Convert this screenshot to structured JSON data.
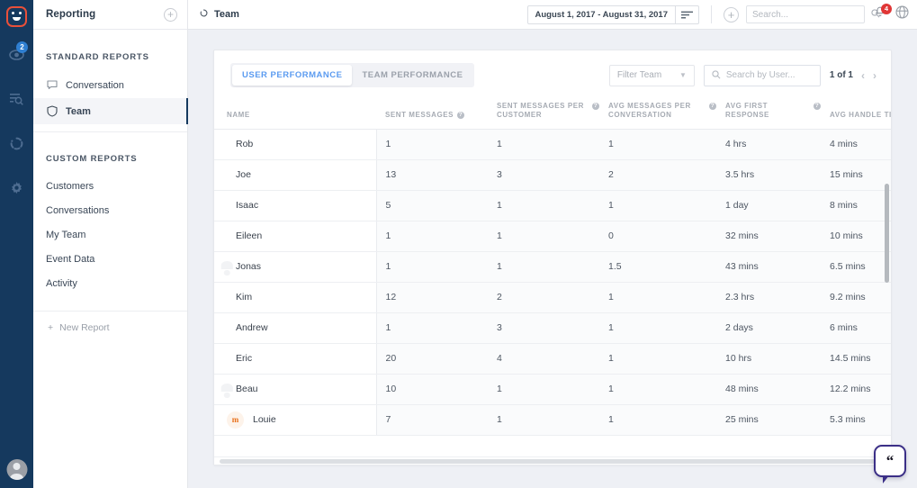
{
  "rail": {
    "logo_name": "app-logo",
    "items": [
      {
        "name": "inbox-icon",
        "badge": "2"
      },
      {
        "name": "search-list-icon",
        "badge": ""
      },
      {
        "name": "reports-icon",
        "badge": ""
      },
      {
        "name": "settings-gear-icon",
        "badge": ""
      }
    ],
    "avatar_name": "user-avatar"
  },
  "sidebar": {
    "title": "Reporting",
    "add_label": "+",
    "standard_section": "STANDARD REPORTS",
    "standard_items": [
      {
        "label": "Conversation",
        "icon": "chat-bubble-icon",
        "active": false
      },
      {
        "label": "Team",
        "icon": "shield-icon",
        "active": true
      }
    ],
    "custom_section": "CUSTOM REPORTS",
    "custom_items": [
      {
        "label": "Customers"
      },
      {
        "label": "Conversations"
      },
      {
        "label": "My Team"
      },
      {
        "label": "Event Data"
      },
      {
        "label": "Activity"
      }
    ],
    "new_report_label": "New Report",
    "new_report_plus": "+"
  },
  "topbar": {
    "breadcrumb": "Team",
    "date_range": "August 1, 2017  -  August 31, 2017",
    "add_label": "+",
    "search_placeholder": "Search...",
    "search_value": "",
    "notification_count": "4"
  },
  "panel": {
    "tabs": [
      {
        "label": "USER PERFORMANCE",
        "active": true
      },
      {
        "label": "TEAM PERFORMANCE",
        "active": false
      }
    ],
    "filter_team_label": "Filter Team",
    "user_search_placeholder": "Search by User...",
    "user_search_value": "",
    "pagination": "1 of 1",
    "prev_label": "‹",
    "next_label": "›"
  },
  "table": {
    "columns": [
      {
        "label": "NAME",
        "help": false
      },
      {
        "label": "SENT MESSAGES",
        "help": true
      },
      {
        "label": "SENT MESSAGES PER CUSTOMER",
        "help": true
      },
      {
        "label": "AVG MESSAGES PER CONVERSATION",
        "help": true
      },
      {
        "label": "AVG FIRST RESPONSE",
        "help": true
      },
      {
        "label": "AVG HANDLE TIME",
        "help": true
      }
    ],
    "help_glyph": "?",
    "rows": [
      {
        "name": "Rob",
        "avatar": "photo",
        "initial": "",
        "sent_messages": "1",
        "sent_per_customer": "1",
        "avg_per_conversation": "1",
        "avg_first_response": "4 hrs",
        "avg_handle_time": "4 mins"
      },
      {
        "name": "Joe",
        "avatar": "photo",
        "initial": "",
        "sent_messages": "13",
        "sent_per_customer": "3",
        "avg_per_conversation": "2",
        "avg_first_response": "3.5 hrs",
        "avg_handle_time": "15 mins"
      },
      {
        "name": "Isaac",
        "avatar": "photo",
        "initial": "",
        "sent_messages": "5",
        "sent_per_customer": "1",
        "avg_per_conversation": "1",
        "avg_first_response": "1 day",
        "avg_handle_time": "8 mins"
      },
      {
        "name": "Eileen",
        "avatar": "photo",
        "initial": "",
        "sent_messages": "1",
        "sent_per_customer": "1",
        "avg_per_conversation": "0",
        "avg_first_response": "32 mins",
        "avg_handle_time": "10 mins"
      },
      {
        "name": "Jonas",
        "avatar": "generic",
        "initial": "",
        "sent_messages": "1",
        "sent_per_customer": "1",
        "avg_per_conversation": "1.5",
        "avg_first_response": "43 mins",
        "avg_handle_time": "6.5 mins"
      },
      {
        "name": "Kim",
        "avatar": "photo",
        "initial": "",
        "sent_messages": "12",
        "sent_per_customer": "2",
        "avg_per_conversation": "1",
        "avg_first_response": "2.3 hrs",
        "avg_handle_time": "9.2 mins"
      },
      {
        "name": "Andrew",
        "avatar": "photo",
        "initial": "",
        "sent_messages": "1",
        "sent_per_customer": "3",
        "avg_per_conversation": "1",
        "avg_first_response": "2 days",
        "avg_handle_time": "6 mins"
      },
      {
        "name": "Eric",
        "avatar": "photo",
        "initial": "",
        "sent_messages": "20",
        "sent_per_customer": "4",
        "avg_per_conversation": "1",
        "avg_first_response": "10 hrs",
        "avg_handle_time": "14.5 mins"
      },
      {
        "name": "Beau",
        "avatar": "generic",
        "initial": "",
        "sent_messages": "10",
        "sent_per_customer": "1",
        "avg_per_conversation": "1",
        "avg_first_response": "48 mins",
        "avg_handle_time": "12.2 mins"
      },
      {
        "name": "Louie",
        "avatar": "letter",
        "initial": "m",
        "sent_messages": "7",
        "sent_per_customer": "1",
        "avg_per_conversation": "1",
        "avg_first_response": "25 mins",
        "avg_handle_time": "5.3 mins"
      }
    ]
  },
  "chat_widget": {
    "name": "help-chat-button",
    "glyph": "“"
  },
  "colors": {
    "rail_bg": "#15395e",
    "accent_blue": "#5b9bf0",
    "badge_red": "#e03636",
    "badge_blue": "#2f7fd1",
    "logo_red": "#e8503a",
    "chat_purple": "#3b2f87"
  }
}
